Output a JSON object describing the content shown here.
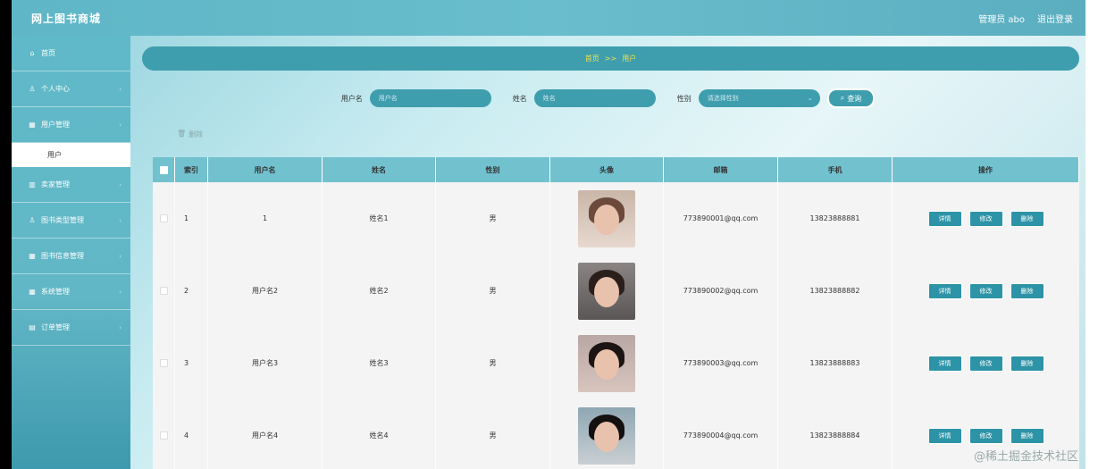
{
  "header": {
    "title": "网上图书商城",
    "admin": "管理员 abo",
    "logout": "退出登录"
  },
  "sidebar": {
    "items": [
      {
        "icon": "⌂",
        "label": "首页"
      },
      {
        "icon": "♙",
        "label": "个人中心"
      },
      {
        "icon": "▦",
        "label": "用户管理",
        "sub": "用户"
      },
      {
        "icon": "▥",
        "label": "卖家管理"
      },
      {
        "icon": "♙",
        "label": "图书类型管理"
      },
      {
        "icon": "▦",
        "label": "图书信息管理"
      },
      {
        "icon": "▦",
        "label": "系统管理"
      },
      {
        "icon": "▤",
        "label": "订单管理"
      }
    ]
  },
  "breadcrumb": {
    "home": "首页",
    "sep": ">>",
    "current": "用户"
  },
  "search": {
    "username_label": "用户名",
    "username_placeholder": "用户名",
    "name_label": "姓名",
    "name_placeholder": "姓名",
    "sex_label": "性别",
    "sex_placeholder": "请选择性别",
    "query": "查询"
  },
  "toolbar": {
    "delete": "删除"
  },
  "table": {
    "headers": [
      "索引",
      "用户名",
      "姓名",
      "性别",
      "头像",
      "邮箱",
      "手机",
      "操作"
    ],
    "rows": [
      {
        "idx": "1",
        "user": "1",
        "name": "姓名1",
        "sex": "男",
        "mail": "773890001@qq.com",
        "phone": "13823888881"
      },
      {
        "idx": "2",
        "user": "用户名2",
        "name": "姓名2",
        "sex": "男",
        "mail": "773890002@qq.com",
        "phone": "13823888882"
      },
      {
        "idx": "3",
        "user": "用户名3",
        "name": "姓名3",
        "sex": "男",
        "mail": "773890003@qq.com",
        "phone": "13823888883"
      },
      {
        "idx": "4",
        "user": "用户名4",
        "name": "姓名4",
        "sex": "男",
        "mail": "773890004@qq.com",
        "phone": "13823888884"
      }
    ],
    "ops": {
      "detail": "详情",
      "edit": "修改",
      "delete": "删除"
    }
  },
  "watermark": "@稀土掘金技术社区",
  "colors": {
    "primary": "#3f9eae",
    "header_bg": "#72c1cf",
    "breadcrumb_text": "#f2e24a"
  }
}
